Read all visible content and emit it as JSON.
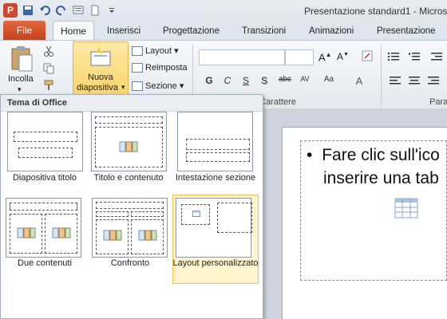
{
  "window": {
    "title": "Presentazione standard1  -  Micros"
  },
  "qat": {
    "app_icon_letter": "P"
  },
  "tabs": {
    "file": "File",
    "home": "Home",
    "items": [
      "Inserisci",
      "Progettazione",
      "Transizioni",
      "Animazioni",
      "Presentazione"
    ]
  },
  "ribbon": {
    "paste_label": "Incolla",
    "new_slide_label_1": "Nuova",
    "new_slide_label_2": "diapositiva",
    "layout_label": "Layout",
    "reset_label": "Reimposta",
    "section_label": "Sezione",
    "font_group_label": "Carattere",
    "paragraph_group_label": "Para",
    "format_buttons": [
      "G",
      "C",
      "S",
      "S",
      "abc",
      "AV",
      "Aa",
      "A"
    ]
  },
  "gallery": {
    "header": "Tema di Office",
    "layouts": [
      {
        "label": "Diapositiva titolo"
      },
      {
        "label": "Titolo e contenuto"
      },
      {
        "label": "Intestazione sezione"
      },
      {
        "label": "Due contenuti"
      },
      {
        "label": "Confronto"
      },
      {
        "label": "Layout personalizzato",
        "selected": true
      }
    ]
  },
  "slide": {
    "bullet": "•",
    "line1": "Fare clic sull'ico",
    "line2": "inserire una tab"
  },
  "colors": {
    "file_tab": "#d04a25",
    "accent": "#f9d56c"
  }
}
